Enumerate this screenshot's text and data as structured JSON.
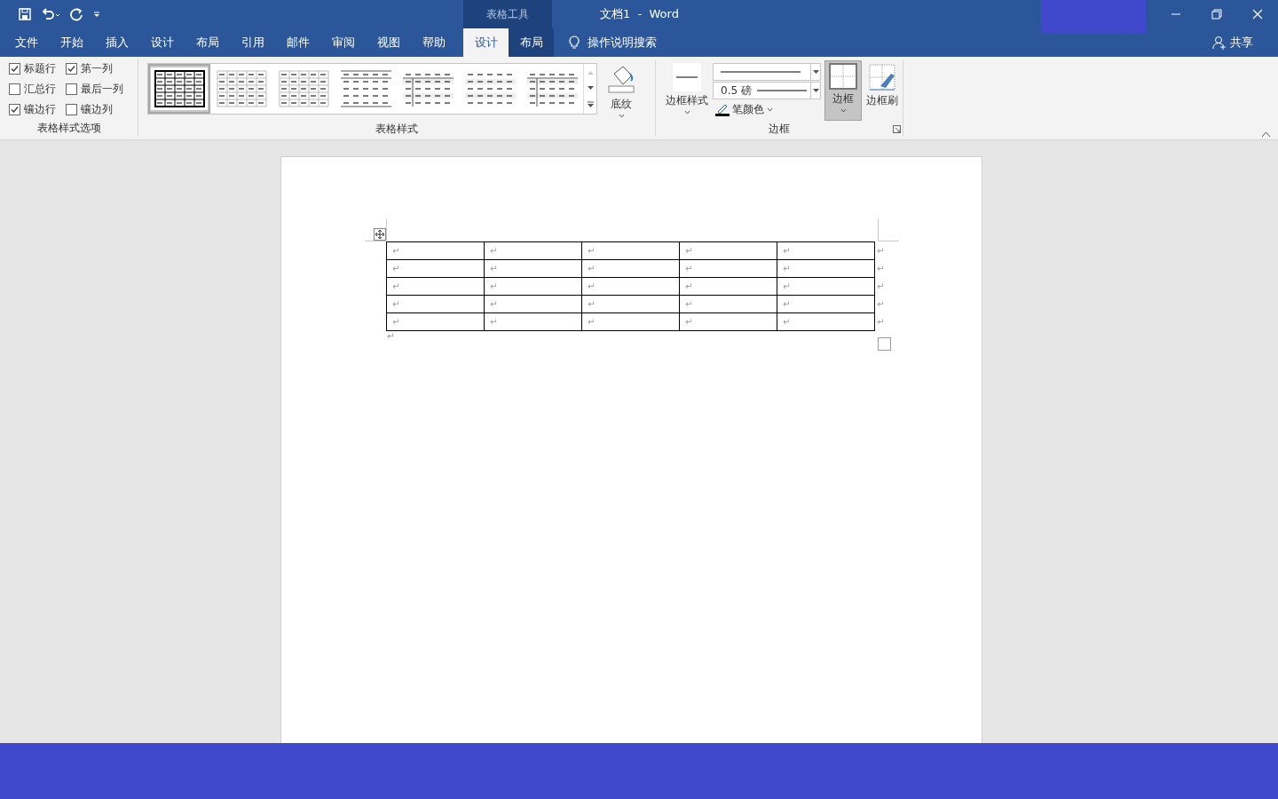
{
  "title_bar": {
    "context_group": "表格工具",
    "title": "文档1  -  Word"
  },
  "tabs": [
    {
      "label": "文件",
      "selected": false,
      "contextual": false
    },
    {
      "label": "开始",
      "selected": false,
      "contextual": false
    },
    {
      "label": "插入",
      "selected": false,
      "contextual": false
    },
    {
      "label": "设计",
      "selected": false,
      "contextual": false
    },
    {
      "label": "布局",
      "selected": false,
      "contextual": false
    },
    {
      "label": "引用",
      "selected": false,
      "contextual": false
    },
    {
      "label": "邮件",
      "selected": false,
      "contextual": false
    },
    {
      "label": "审阅",
      "selected": false,
      "contextual": false
    },
    {
      "label": "视图",
      "selected": false,
      "contextual": false
    },
    {
      "label": "帮助",
      "selected": false,
      "contextual": false
    },
    {
      "label": "设计",
      "selected": true,
      "contextual": true
    },
    {
      "label": "布局",
      "selected": false,
      "contextual": true
    }
  ],
  "tell_me": "操作说明搜索",
  "share": "共享",
  "ribbon": {
    "style_options": {
      "group_label": "表格样式选项",
      "items": [
        {
          "label": "标题行",
          "checked": true
        },
        {
          "label": "第一列",
          "checked": true
        },
        {
          "label": "汇总行",
          "checked": false
        },
        {
          "label": "最后一列",
          "checked": false
        },
        {
          "label": "镶边行",
          "checked": true
        },
        {
          "label": "镶边列",
          "checked": false
        }
      ]
    },
    "table_styles": {
      "group_label": "表格样式",
      "styles": [
        {
          "kind": "grid",
          "selected": true
        },
        {
          "kind": "light-grid",
          "selected": false
        },
        {
          "kind": "light-grid",
          "selected": false
        },
        {
          "kind": "rules",
          "selected": false
        },
        {
          "kind": "header-column",
          "selected": false
        },
        {
          "kind": "banded",
          "selected": false
        },
        {
          "kind": "header-column",
          "selected": false
        }
      ]
    },
    "shading": "底纹",
    "borders": {
      "group_label": "边框",
      "border_styles": "边框样式",
      "line_weight": "0.5 磅",
      "pen_color": "笔颜色",
      "borders_button": {
        "label": "边框",
        "pressed": true
      },
      "border_painter": "边框刷"
    }
  },
  "document": {
    "table": {
      "rows": [
        {
          "cells": [
            "↵",
            "↵",
            "↵",
            "↵",
            "↵"
          ],
          "end_mark": "↵"
        },
        {
          "cells": [
            "↵",
            "↵",
            "↵",
            "↵",
            "↵"
          ],
          "end_mark": "↵"
        },
        {
          "cells": [
            "↵",
            "↵",
            "↵",
            "↵",
            "↵"
          ],
          "end_mark": "↵"
        },
        {
          "cells": [
            "↵",
            "↵",
            "↵",
            "↵",
            "↵"
          ],
          "end_mark": "↵"
        },
        {
          "cells": [
            "↵",
            "↵",
            "↵",
            "↵",
            "↵"
          ],
          "end_mark": "↵"
        }
      ]
    },
    "after_table_mark": "↵"
  }
}
